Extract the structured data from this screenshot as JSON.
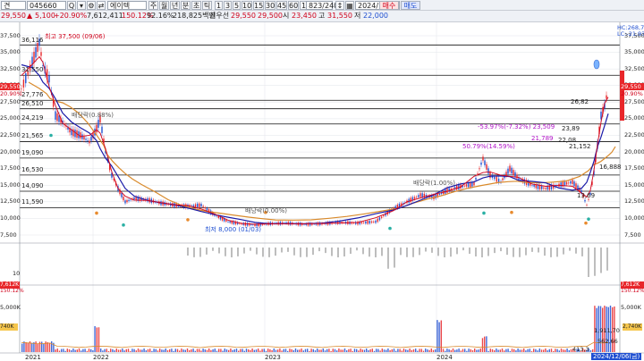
{
  "toolbar": {
    "combo_suffix": "견",
    "code": "045660",
    "tools": [
      "Q",
      "▾",
      "⚙",
      "⇄"
    ],
    "stock_name": "에이텍",
    "period_buttons": [
      "주",
      "월",
      "년",
      "분",
      "초",
      "틱"
    ],
    "minute_buttons": [
      "1",
      "3",
      "5",
      "10",
      "15",
      "30",
      "45",
      "60",
      "1"
    ],
    "count": "823",
    "count_total": "/2400",
    "date": "2024/12/06",
    "buy_label": "매수",
    "sell_label": "매도"
  },
  "quote": {
    "price": "29,550",
    "arrow": "▲",
    "change": "5,100",
    "change_pct": "+20.90%",
    "volume": "7,612,411",
    "volume_ratio": "150.12%",
    "turnover": "92.16%",
    "trade_value": "218,825백만",
    "best_ask_label": "최우선",
    "best_ask": "29,550",
    "best_bid": "29,500",
    "open_label": "시",
    "open": "23,450",
    "high_label": "고",
    "high": "31,550",
    "low_label": "저",
    "low": "22,000"
  },
  "price_axis": {
    "right_ticks": [
      "37,500",
      "35,000",
      "32,500",
      "30,000",
      "27,500",
      "25,000",
      "22,500",
      "20,000",
      "17,500",
      "15,000",
      "12,500",
      "10,000",
      "7,500"
    ],
    "left_ticks": [
      "37,500",
      "35,000",
      "32,500",
      "30,000",
      "27,500",
      "25,000",
      "22,500",
      "20,000",
      "17,500",
      "15,000",
      "12,500",
      "10,000",
      "7,500"
    ],
    "top_right_label": "HC:268,75",
    "top_right_label2": "LC:-21.93",
    "current_left": "29,550",
    "current_left_pct": "20.90%",
    "current_right": "29,550",
    "current_right_pct": "20.90%"
  },
  "hlines": [
    "36,116",
    "31,550",
    "27,776",
    "26,510",
    "24,219",
    "21,565",
    "19,090",
    "16,530",
    "14,090",
    "11,590"
  ],
  "annotations": {
    "high": "최고 37,500 (09/06)",
    "low": "최저 8,000 (01/03)",
    "div1": "배당락(0.88%)",
    "div2": "배당락(0.00%)",
    "div3": "배당락(1.00%)",
    "up_move": "50.79%(14.59%)",
    "down_move": "-53.97%(-7.32%) 23,509",
    "val_21789": "21,789",
    "val_21152": "21,152",
    "val_16888": "16,888",
    "val_13692": "13,69",
    "val_26821": "26,82",
    "val_23891": "23,89",
    "val_22080": "22,08"
  },
  "volume_axis": {
    "left_top_1": "7,612K",
    "left_top_2": "150.12%",
    "left_5000": "5,000K",
    "left_740": "740K",
    "right_top_1": "7,612K",
    "right_top_2": "150.12%",
    "right_5000": "5,000K",
    "right_740": "2,740K",
    "ma_label_1": "1,911,70",
    "ma_label_2": "562,66",
    "ma_label_3": "413,3"
  },
  "indicator_axis": {
    "tick": "10"
  },
  "time_axis": {
    "labels": [
      "2021",
      "2022",
      "2023",
      "2024"
    ],
    "cursor_date": "2024/12/06(금)"
  },
  "colors": {
    "up": "#e8272a",
    "down": "#1f4fd1",
    "ma_short": "#d0021b",
    "ma_mid": "#1a1aa8",
    "ma_long": "#d98a2b",
    "grid": "#e2e5ea"
  }
}
